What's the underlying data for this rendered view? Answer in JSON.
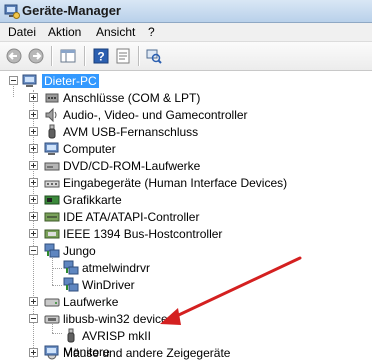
{
  "window": {
    "title": "Geräte-Manager"
  },
  "menu": [
    "Datei",
    "Aktion",
    "Ansicht",
    "?"
  ],
  "toolbar": {
    "buttons": [
      "back-icon",
      "forward-icon",
      "show-hide-tree-icon",
      "help-icon",
      "properties-icon",
      "scan-hardware-icon"
    ]
  },
  "tree": {
    "root": "Dieter-PC",
    "items": [
      {
        "label": "Anschlüsse (COM & LPT)",
        "icon": "port-icon"
      },
      {
        "label": "Audio-, Video- und Gamecontroller",
        "icon": "sound-icon"
      },
      {
        "label": "AVM USB-Fernanschluss",
        "icon": "usb-icon"
      },
      {
        "label": "Computer",
        "icon": "computer-icon"
      },
      {
        "label": "DVD/CD-ROM-Laufwerke",
        "icon": "dvd-icon"
      },
      {
        "label": "Eingabegeräte (Human Interface Devices)",
        "icon": "hid-icon"
      },
      {
        "label": "Grafikkarte",
        "icon": "display-adapter-icon"
      },
      {
        "label": "IDE ATA/ATAPI-Controller",
        "icon": "ide-icon"
      },
      {
        "label": "IEEE 1394 Bus-Hostcontroller",
        "icon": "firewire-icon"
      },
      {
        "label": "Jungo",
        "icon": "network-icon",
        "expanded": true,
        "children": [
          {
            "label": "atmelwindrvr",
            "icon": "network-icon"
          },
          {
            "label": "WinDriver",
            "icon": "network-icon"
          }
        ]
      },
      {
        "label": "Laufwerke",
        "icon": "disk-icon"
      },
      {
        "label": "libusb-win32 devices",
        "icon": "usb-icon",
        "expanded": true,
        "children": [
          {
            "label": "AVRISP mkII",
            "icon": "usb-icon"
          }
        ]
      },
      {
        "label": "Mäuse und andere Zeigegeräte",
        "icon": "mouse-icon"
      },
      {
        "label": "Monitore",
        "icon": "monitor-icon"
      }
    ]
  },
  "annotation": {
    "arrow_color": "#d42020"
  }
}
